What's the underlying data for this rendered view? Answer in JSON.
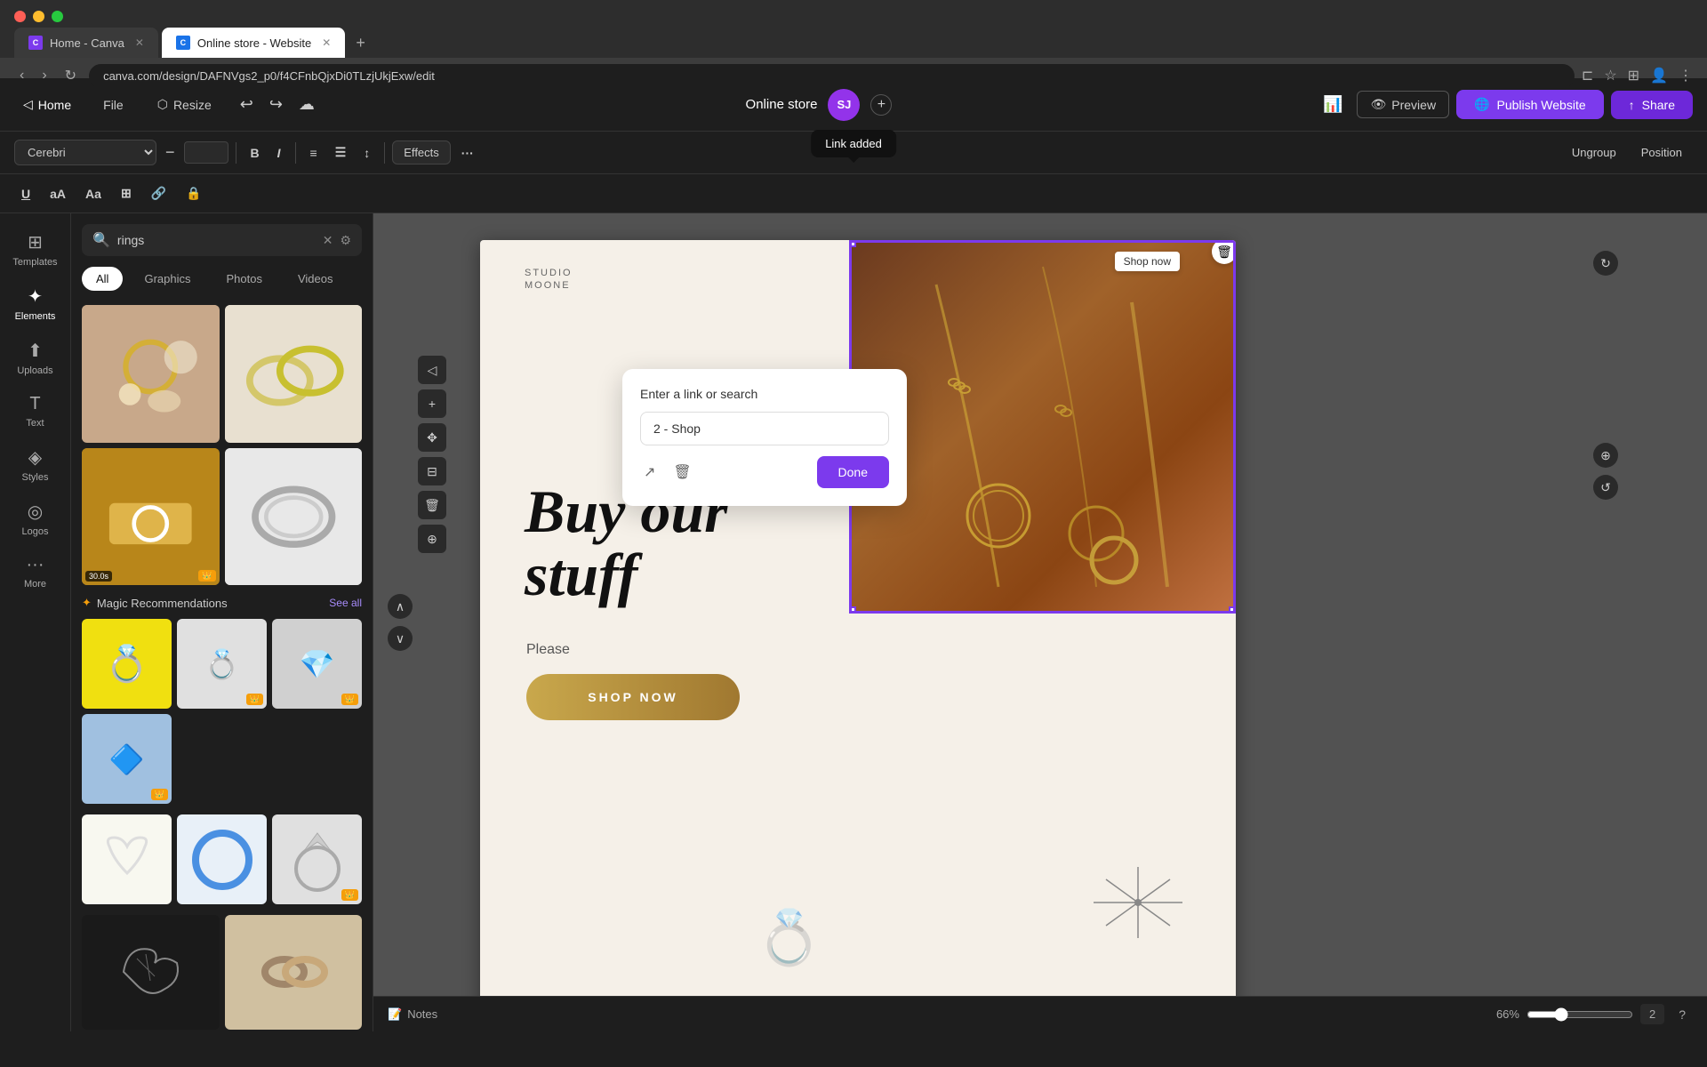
{
  "browser": {
    "tabs": [
      {
        "id": "tab1",
        "label": "Home - Canva",
        "favicon_type": "canva",
        "active": false
      },
      {
        "id": "tab2",
        "label": "Online store - Website",
        "favicon_type": "blue",
        "active": true
      }
    ],
    "address": "canva.com/design/DAFNVgs2_p0/f4CFnbQjxDi0TLzjUkjExw/edit",
    "new_tab_label": "+"
  },
  "topbar": {
    "home_label": "Home",
    "file_label": "File",
    "resize_label": "Resize",
    "project_name": "Online store",
    "avatar_initials": "SJ",
    "analytics_icon": "chart-icon",
    "preview_label": "Preview",
    "publish_label": "Publish Website",
    "share_label": "Share"
  },
  "format_toolbar": {
    "font_name": "Cerebri",
    "font_size": "",
    "bold_label": "B",
    "italic_label": "I",
    "align_label": "≡",
    "list_label": "≡",
    "spacing_label": "↕",
    "effects_label": "Effects",
    "more_label": "···",
    "ungroup_label": "Ungroup",
    "position_label": "Position",
    "link_added_badge": "Link added"
  },
  "format_toolbar2": {
    "underline_label": "U",
    "aa_label": "aA",
    "transform_label": "Aa",
    "dots_label": "⋮⋮",
    "link_label": "🔗",
    "lock_label": "🔒"
  },
  "left_sidebar": {
    "items": [
      {
        "id": "templates",
        "label": "Templates",
        "icon": "⊞"
      },
      {
        "id": "elements",
        "label": "Elements",
        "icon": "✦"
      },
      {
        "id": "uploads",
        "label": "Uploads",
        "icon": "⬆"
      },
      {
        "id": "text",
        "label": "Text",
        "icon": "T"
      },
      {
        "id": "styles",
        "label": "Styles",
        "icon": "◈"
      },
      {
        "id": "logos",
        "label": "Logos",
        "icon": "◎"
      },
      {
        "id": "more",
        "label": "More",
        "icon": "···"
      }
    ]
  },
  "panel": {
    "search_placeholder": "rings",
    "search_value": "rings",
    "tabs": [
      "All",
      "Graphics",
      "Photos",
      "Videos"
    ],
    "active_tab": "All",
    "magic_section": {
      "title": "Magic Recommendations",
      "see_all": "See all",
      "items": [
        {
          "label": "gold-ring",
          "icon": "💍"
        },
        {
          "label": "silver-ring",
          "icon": "💍"
        },
        {
          "label": "diamond-ring",
          "icon": "💎"
        },
        {
          "label": "gem-ring",
          "icon": "🔷"
        }
      ]
    }
  },
  "canvas": {
    "studio_line1": "STUDIO",
    "studio_line2": "MOONE",
    "hero_text": "Buy our\nstuff",
    "please_text": "Please",
    "shop_now_label": "SHOP NOW",
    "shop_now_tag": "Shop now",
    "zoom_level": "66%",
    "page_number": "2"
  },
  "link_dialog": {
    "title": "Enter a link or search",
    "input_value": "2 - Shop",
    "done_label": "Done"
  },
  "bottom_bar": {
    "notes_label": "Notes",
    "zoom": "66%",
    "page_indicator": "2"
  }
}
